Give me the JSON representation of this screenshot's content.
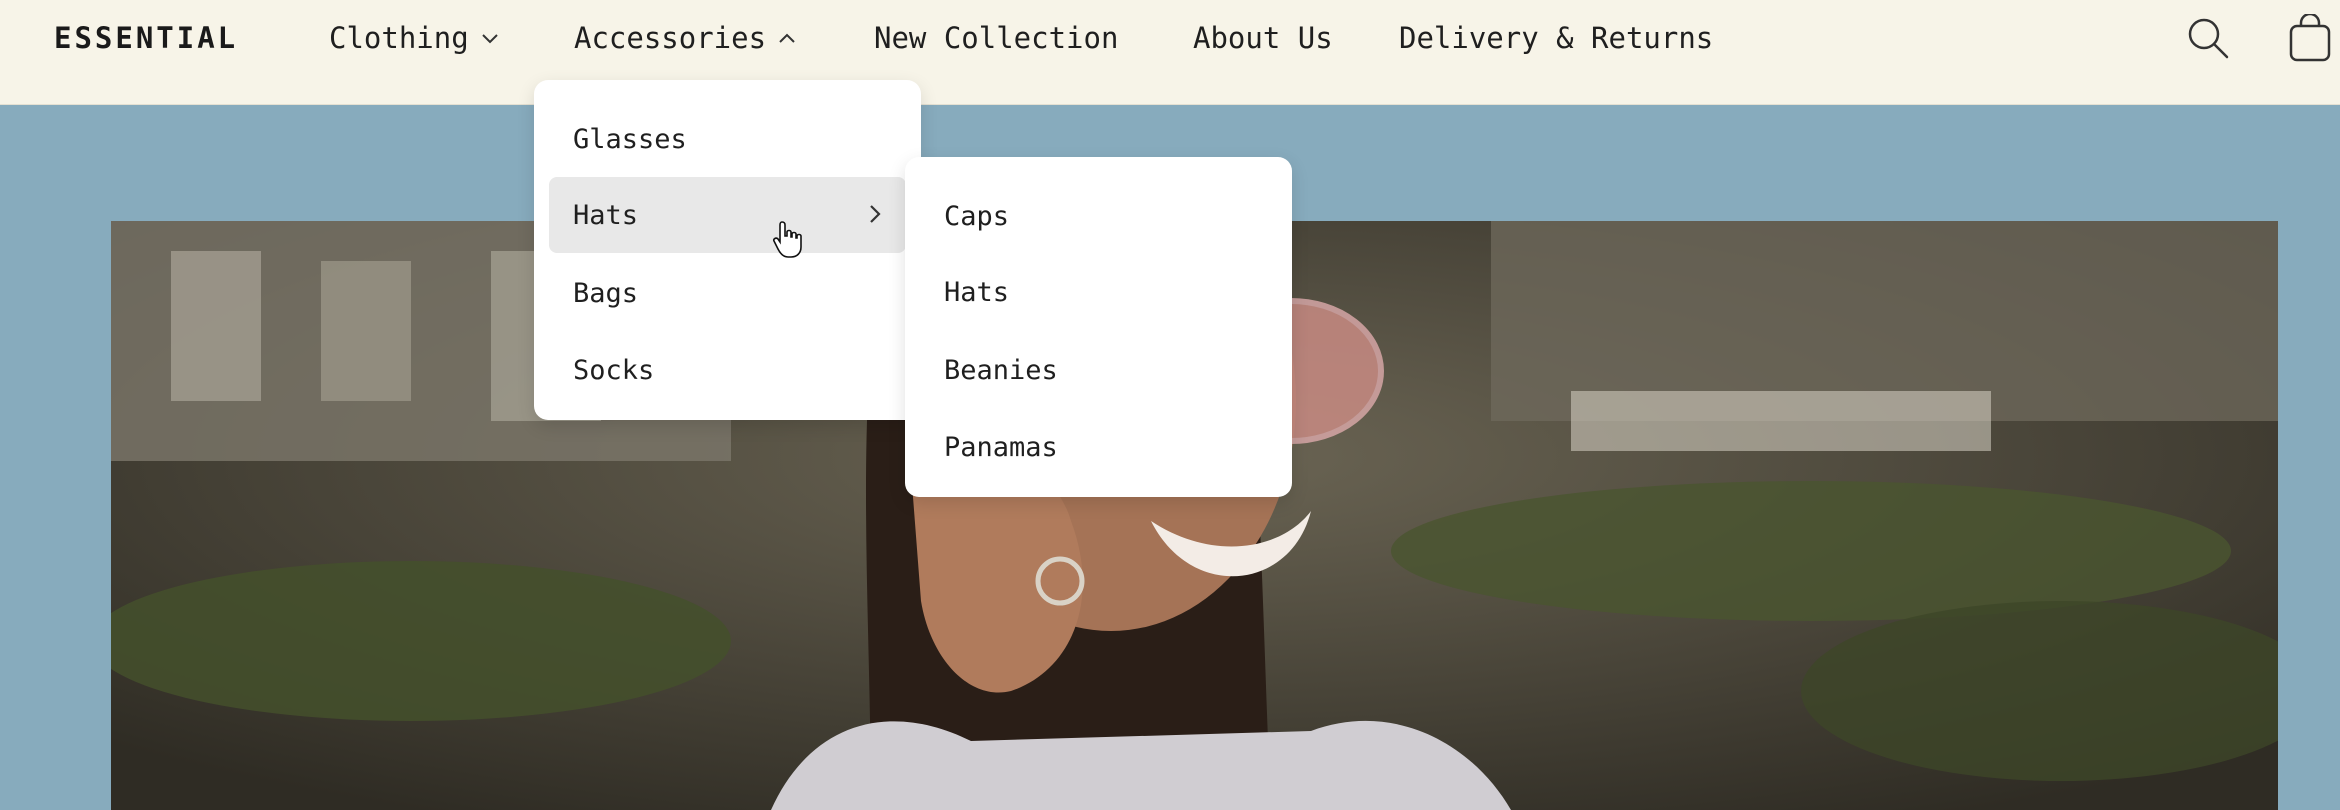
{
  "header": {
    "logo": "ESSENTIAL",
    "nav": {
      "clothing": "Clothing",
      "accessories": "Accessories",
      "new_collection": "New Collection",
      "about_us": "About Us",
      "delivery": "Delivery & Returns"
    },
    "icons": [
      "search-icon",
      "shopping-bag-icon"
    ]
  },
  "accessories_menu": {
    "items": [
      "Glasses",
      "Hats",
      "Bags",
      "Socks"
    ],
    "active": "Hats"
  },
  "hats_submenu": {
    "items": [
      "Caps",
      "Hats",
      "Beanies",
      "Panamas"
    ]
  },
  "colors": {
    "header_bg": "#f7f4e8",
    "page_bg": "#87abbd",
    "menu_bg": "#ffffff",
    "active_item_bg": "#e8e8e8",
    "text": "#1f1f1f"
  }
}
